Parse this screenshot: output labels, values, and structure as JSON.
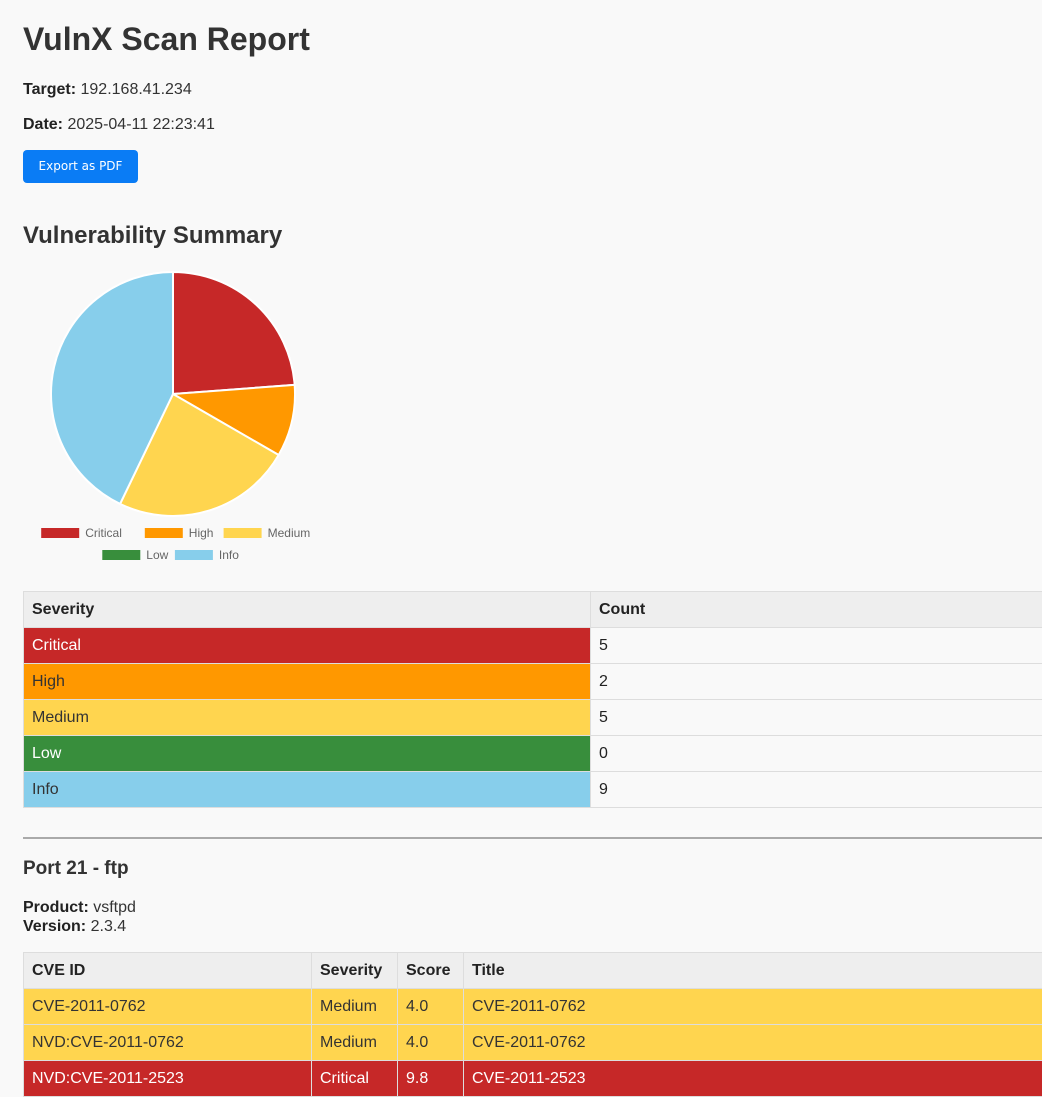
{
  "header": {
    "title": "VulnX Scan Report",
    "target_label": "Target:",
    "target_value": "192.168.41.234",
    "date_label": "Date:",
    "date_value": "2025-04-11 22:23:41",
    "export_button": "Export as PDF"
  },
  "summary": {
    "title": "Vulnerability Summary",
    "table_headers": [
      "Severity",
      "Count"
    ],
    "rows": [
      {
        "severity": "Critical",
        "count": "5"
      },
      {
        "severity": "High",
        "count": "2"
      },
      {
        "severity": "Medium",
        "count": "5"
      },
      {
        "severity": "Low",
        "count": "0"
      },
      {
        "severity": "Info",
        "count": "9"
      }
    ]
  },
  "colors": {
    "Critical": "#c62828",
    "High": "#ff9800",
    "Medium": "#ffd54f",
    "Low": "#388e3c",
    "Info": "#87ceeb",
    "accent_button": "#0a7cf5"
  },
  "chart_data": {
    "type": "pie",
    "categories": [
      "Critical",
      "High",
      "Medium",
      "Low",
      "Info"
    ],
    "values": [
      5,
      2,
      5,
      0,
      9
    ],
    "colors": [
      "#c62828",
      "#ff9800",
      "#ffd54f",
      "#388e3c",
      "#87ceeb"
    ],
    "legend_position": "bottom"
  },
  "port_section": {
    "title": "Port 21 - ftp",
    "product_label": "Product:",
    "product_value": "vsftpd",
    "version_label": "Version:",
    "version_value": "2.3.4",
    "table_headers": [
      "CVE ID",
      "Severity",
      "Score",
      "Title"
    ],
    "rows": [
      {
        "cve_id": "CVE-2011-0762",
        "severity": "Medium",
        "score": "4.0",
        "title": "CVE-2011-0762"
      },
      {
        "cve_id": "NVD:CVE-2011-0762",
        "severity": "Medium",
        "score": "4.0",
        "title": "CVE-2011-0762"
      },
      {
        "cve_id": "NVD:CVE-2011-2523",
        "severity": "Critical",
        "score": "9.8",
        "title": "CVE-2011-2523"
      }
    ]
  }
}
